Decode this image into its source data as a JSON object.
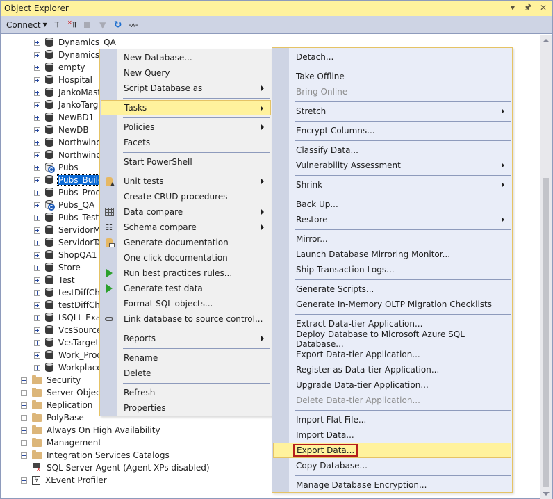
{
  "panel": {
    "title": "Object Explorer",
    "title_icons": [
      "dropdown-icon",
      "pin-icon",
      "close-icon"
    ]
  },
  "toolbar": {
    "connect_label": "Connect",
    "icons": [
      "connect-plug-icon",
      "disconnect-plug-icon",
      "stop-icon",
      "filter-icon",
      "refresh-icon",
      "activity-monitor-icon"
    ]
  },
  "tree": {
    "databases": [
      {
        "name": "Dynamics_QA",
        "icon": "database-icon"
      },
      {
        "name": "DynamicsS",
        "icon": "database-icon"
      },
      {
        "name": "empty",
        "icon": "database-icon"
      },
      {
        "name": "Hospital",
        "icon": "database-icon"
      },
      {
        "name": "JankoMaste",
        "icon": "database-icon"
      },
      {
        "name": "JankoTarge",
        "icon": "database-icon"
      },
      {
        "name": "NewBD1",
        "icon": "database-icon"
      },
      {
        "name": "NewDB",
        "icon": "database-icon"
      },
      {
        "name": "Northwind",
        "icon": "database-icon"
      },
      {
        "name": "Northwind_",
        "icon": "database-icon"
      },
      {
        "name": "Pubs",
        "icon": "database-offline-icon"
      },
      {
        "name": "Pubs_Build",
        "icon": "database-icon",
        "selected": true
      },
      {
        "name": "Pubs_Produ",
        "icon": "database-icon"
      },
      {
        "name": "Pubs_QA",
        "icon": "database-offline-icon"
      },
      {
        "name": "Pubs_Test",
        "icon": "database-icon"
      },
      {
        "name": "ServidorMa",
        "icon": "database-icon"
      },
      {
        "name": "ServidorTar",
        "icon": "database-icon"
      },
      {
        "name": "ShopQA1",
        "icon": "database-icon"
      },
      {
        "name": "Store",
        "icon": "database-icon"
      },
      {
        "name": "Test",
        "icon": "database-icon"
      },
      {
        "name": "testDiffCha",
        "icon": "database-icon"
      },
      {
        "name": "testDiffCha",
        "icon": "database-icon"
      },
      {
        "name": "tSQLt_Exam",
        "icon": "database-icon"
      },
      {
        "name": "VcsSource",
        "icon": "database-icon"
      },
      {
        "name": "VcsTarget",
        "icon": "database-icon"
      },
      {
        "name": "Work_Prod",
        "icon": "database-icon"
      },
      {
        "name": "Workplace",
        "icon": "database-icon"
      }
    ],
    "server_nodes": [
      {
        "name": "Security",
        "icon": "folder-icon"
      },
      {
        "name": "Server Objects",
        "icon": "folder-icon"
      },
      {
        "name": "Replication",
        "icon": "folder-icon"
      },
      {
        "name": "PolyBase",
        "icon": "folder-icon"
      },
      {
        "name": "Always On High Availability",
        "icon": "folder-icon"
      },
      {
        "name": "Management",
        "icon": "folder-icon"
      },
      {
        "name": "Integration Services Catalogs",
        "icon": "folder-icon"
      },
      {
        "name": "SQL Server Agent (Agent XPs disabled)",
        "icon": "sql-agent-icon"
      },
      {
        "name": "XEvent Profiler",
        "icon": "xevent-icon"
      }
    ]
  },
  "context_menu": {
    "items": [
      {
        "label": "New Database..."
      },
      {
        "label": "New Query"
      },
      {
        "label": "Script Database as",
        "submenu": true
      },
      {
        "sep": true
      },
      {
        "label": "Tasks",
        "submenu": true,
        "highlighted": true
      },
      {
        "sep": true
      },
      {
        "label": "Policies",
        "submenu": true
      },
      {
        "label": "Facets"
      },
      {
        "sep": true
      },
      {
        "label": "Start PowerShell"
      },
      {
        "sep": true
      },
      {
        "label": "Unit tests",
        "submenu": true,
        "icon": "unit-tests-icon"
      },
      {
        "label": "Create CRUD procedures"
      },
      {
        "label": "Data compare",
        "submenu": true,
        "icon": "data-compare-icon"
      },
      {
        "label": "Schema compare",
        "submenu": true,
        "icon": "schema-compare-icon"
      },
      {
        "label": "Generate documentation",
        "icon": "documentation-icon"
      },
      {
        "label": "One click documentation"
      },
      {
        "label": "Run best practices rules...",
        "icon": "run-icon"
      },
      {
        "label": "Generate test data",
        "icon": "run-icon"
      },
      {
        "label": "Format SQL objects..."
      },
      {
        "label": "Link database to source control...",
        "icon": "link-icon"
      },
      {
        "sep": true
      },
      {
        "label": "Reports",
        "submenu": true
      },
      {
        "sep": true
      },
      {
        "label": "Rename"
      },
      {
        "label": "Delete"
      },
      {
        "sep": true
      },
      {
        "label": "Refresh"
      },
      {
        "label": "Properties"
      }
    ]
  },
  "tasks_submenu": {
    "items": [
      {
        "label": "Detach..."
      },
      {
        "sep": true
      },
      {
        "label": "Take Offline"
      },
      {
        "label": "Bring Online",
        "disabled": true
      },
      {
        "sep": true
      },
      {
        "label": "Stretch",
        "submenu": true
      },
      {
        "sep": true
      },
      {
        "label": "Encrypt Columns..."
      },
      {
        "sep": true
      },
      {
        "label": "Classify Data..."
      },
      {
        "label": "Vulnerability Assessment",
        "submenu": true
      },
      {
        "sep": true
      },
      {
        "label": "Shrink",
        "submenu": true
      },
      {
        "sep": true
      },
      {
        "label": "Back Up..."
      },
      {
        "label": "Restore",
        "submenu": true
      },
      {
        "sep": true
      },
      {
        "label": "Mirror..."
      },
      {
        "label": "Launch Database Mirroring Monitor..."
      },
      {
        "label": "Ship Transaction Logs..."
      },
      {
        "sep": true
      },
      {
        "label": "Generate Scripts..."
      },
      {
        "label": "Generate In-Memory OLTP Migration Checklists"
      },
      {
        "sep": true
      },
      {
        "label": "Extract Data-tier Application..."
      },
      {
        "label": "Deploy Database to Microsoft Azure SQL Database..."
      },
      {
        "label": "Export Data-tier Application..."
      },
      {
        "label": "Register as Data-tier Application..."
      },
      {
        "label": "Upgrade Data-tier Application..."
      },
      {
        "label": "Delete Data-tier Application...",
        "disabled": true
      },
      {
        "sep": true
      },
      {
        "label": "Import Flat File..."
      },
      {
        "label": "Import Data..."
      },
      {
        "label": "Export Data...",
        "highlighted": true,
        "annotated": true
      },
      {
        "label": "Copy Database..."
      },
      {
        "sep": true
      },
      {
        "label": "Manage Database Encryption..."
      }
    ]
  },
  "colors": {
    "title_bar": "#fff29d",
    "toolbar": "#ced4e4",
    "selection": "#0b6ad6",
    "menu_border": "#e5c365",
    "annotation_box": "#b51d1d"
  }
}
